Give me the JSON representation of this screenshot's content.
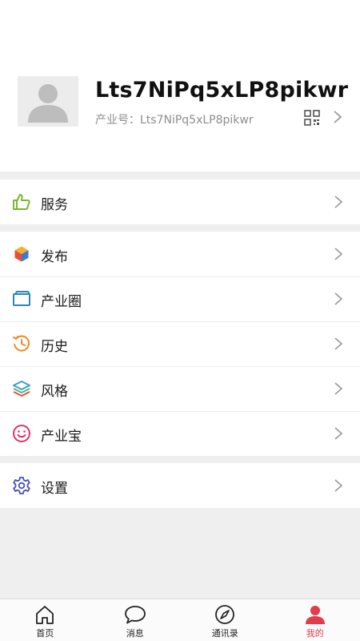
{
  "profile": {
    "name": "Lts7NiPq5xLP8pikwr",
    "id_label": "产业号：",
    "id_value": "Lts7NiPq5xLP8pikwr"
  },
  "menu_groups": [
    [
      {
        "key": "services",
        "label": "服务",
        "icon": "thumbs-up-icon",
        "color": "#7cb82f"
      }
    ],
    [
      {
        "key": "publish",
        "label": "发布",
        "icon": "cube-icon",
        "color": "#e84d3c"
      },
      {
        "key": "industry-circle",
        "label": "产业圈",
        "icon": "card-icon",
        "color": "#2a86b8"
      },
      {
        "key": "history",
        "label": "历史",
        "icon": "clock-icon",
        "color": "#f08a24"
      },
      {
        "key": "style",
        "label": "风格",
        "icon": "layers-icon",
        "color": "#3aa0c8"
      },
      {
        "key": "industry-treasure",
        "label": "产业宝",
        "icon": "smiley-icon",
        "color": "#e0336a"
      }
    ],
    [
      {
        "key": "settings",
        "label": "设置",
        "icon": "gear-icon",
        "color": "#4a4fb0"
      }
    ]
  ],
  "tabs": [
    {
      "key": "home",
      "label": "首页",
      "icon": "home-icon",
      "active": false
    },
    {
      "key": "messages",
      "label": "消息",
      "icon": "chat-bubble-icon",
      "active": false
    },
    {
      "key": "contacts",
      "label": "通讯录",
      "icon": "compass-icon",
      "active": false
    },
    {
      "key": "mine",
      "label": "我的",
      "icon": "person-icon",
      "active": true
    }
  ],
  "colors": {
    "accent": "#e23c4b",
    "background": "#efefef"
  }
}
